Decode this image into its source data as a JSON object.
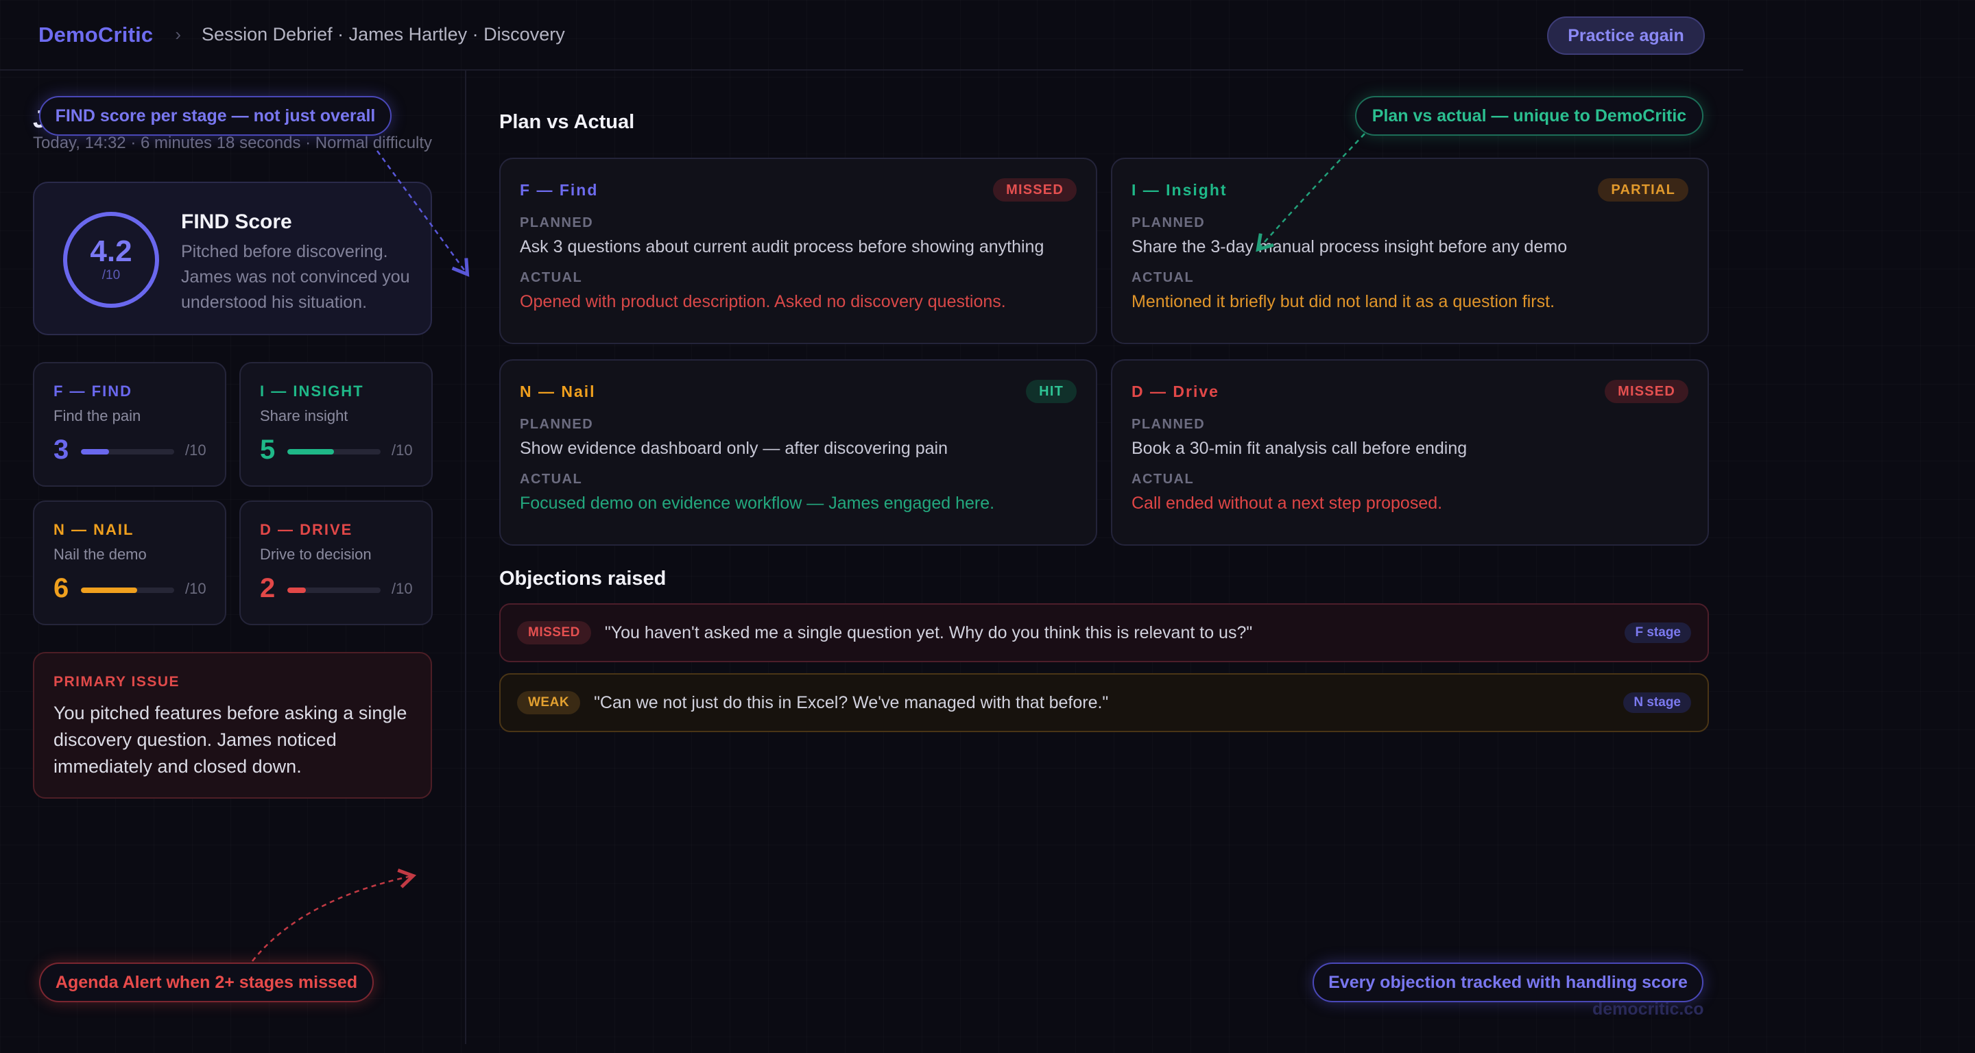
{
  "header": {
    "brand": "DemoCritic",
    "breadcrumb_separator": "›",
    "breadcrumb": "Session Debrief · James Hartley · Discovery",
    "practice_button": "Practice again"
  },
  "session": {
    "lead_initial": "J",
    "meta": "Today, 14:32 · 6 minutes 18 seconds · Normal difficulty"
  },
  "find_score": {
    "value": "4.2",
    "denominator": "/10",
    "title": "FIND Score",
    "description": "Pitched before discovering. James was not convinced you understood his situation."
  },
  "stages": [
    {
      "title": "F — FIND",
      "subtitle": "Find the pain",
      "score": "3",
      "fraction": 0.3,
      "denominator": "/10",
      "color": "#6a68ee"
    },
    {
      "title": "I — INSIGHT",
      "subtitle": "Share insight",
      "score": "5",
      "fraction": 0.5,
      "denominator": "/10",
      "color": "#1fb888"
    },
    {
      "title": "N — NAIL",
      "subtitle": "Nail the demo",
      "score": "6",
      "fraction": 0.6,
      "denominator": "/10",
      "color": "#f0a01e"
    },
    {
      "title": "D — DRIVE",
      "subtitle": "Drive to decision",
      "score": "2",
      "fraction": 0.2,
      "denominator": "/10",
      "color": "#e24848"
    }
  ],
  "primary_issue": {
    "label": "PRIMARY ISSUE",
    "text": "You pitched features before asking a single discovery question. James noticed immediately and closed down."
  },
  "plan_vs_actual": {
    "title": "Plan vs Actual",
    "planned_label": "PLANNED",
    "actual_label": "ACTUAL",
    "cards": [
      {
        "title": "F — Find",
        "badge": "MISSED",
        "planned": "Ask 3 questions about current audit process before showing anything",
        "actual": "Opened with product description. Asked no discovery questions.",
        "title_color": "#6e6cf0",
        "actual_color": "#d94848"
      },
      {
        "title": "I — Insight",
        "badge": "PARTIAL",
        "planned": "Share the 3-day manual process insight before any demo",
        "actual": "Mentioned it briefly but did not land it as a question first.",
        "title_color": "#1fb888",
        "actual_color": "#e0952a"
      },
      {
        "title": "N — Nail",
        "badge": "HIT",
        "planned": "Show evidence dashboard only — after discovering pain",
        "actual": "Focused demo on evidence workflow — James engaged here.",
        "title_color": "#f0a01e",
        "actual_color": "#23a87e"
      },
      {
        "title": "D — Drive",
        "badge": "MISSED",
        "planned": "Book a 30-min fit analysis call before ending",
        "actual": "Call ended without a next step proposed.",
        "title_color": "#e24848",
        "actual_color": "#e04646"
      }
    ]
  },
  "objections": {
    "title": "Objections raised",
    "items": [
      {
        "status": "MISSED",
        "quote": "\"You haven't asked me a single question yet. Why do you think this is relevant to us?\"",
        "stage": "F stage"
      },
      {
        "status": "WEAK",
        "quote": "\"Can we not just do this in Excel? We've managed with that before.\"",
        "stage": "N stage"
      }
    ]
  },
  "callouts": {
    "find_per_stage": "FIND score per stage — not just overall",
    "plan_vs_actual": "Plan vs actual — unique to DemoCritic",
    "agenda_alert": "Agenda Alert when 2+ stages missed",
    "objections_tracked": "Every objection tracked with handling score"
  },
  "watermark": "democritic.co"
}
